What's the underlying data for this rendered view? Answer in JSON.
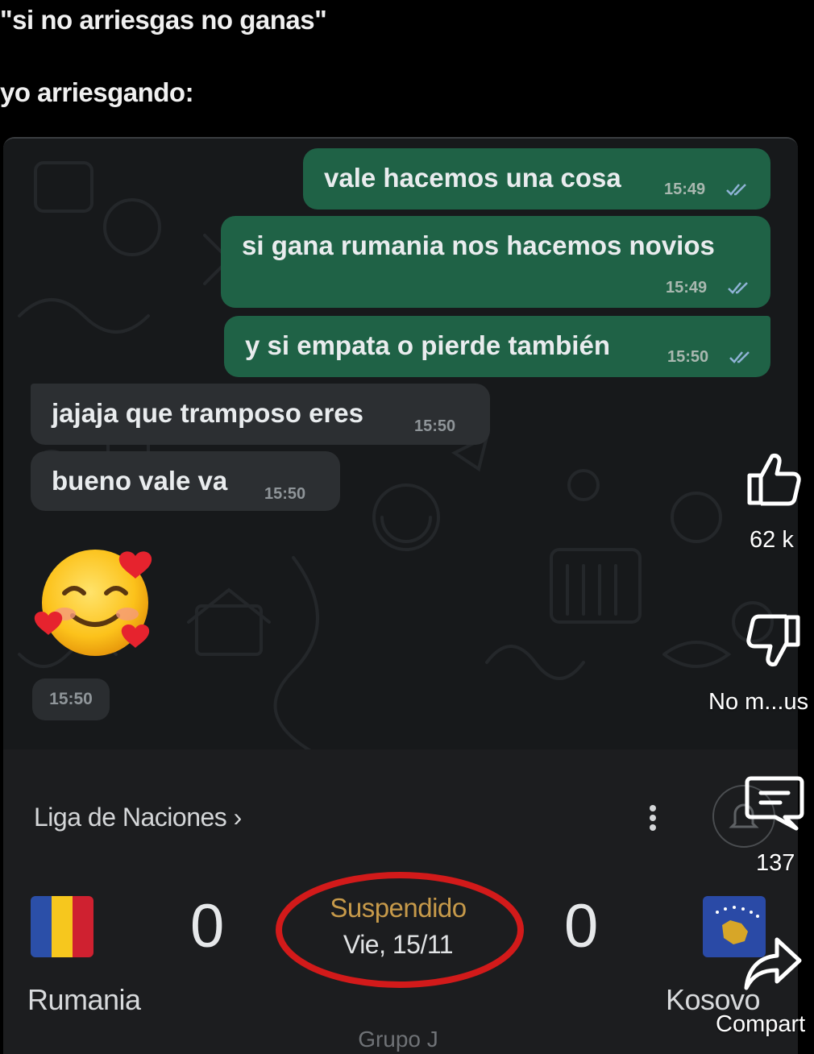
{
  "caption": {
    "line1": "\"si no arriesgas no ganas\"",
    "line2": "yo arriesgando:"
  },
  "chat": {
    "messages": [
      {
        "direction": "out",
        "text": "vale hacemos una cosa",
        "time": "15:49",
        "read": true
      },
      {
        "direction": "out",
        "text": "si gana rumania nos hacemos novios",
        "time": "15:49",
        "read": true
      },
      {
        "direction": "out",
        "text": "y si empata o pierde también",
        "time": "15:50",
        "read": true
      },
      {
        "direction": "in",
        "text": "jajaja que tramposo eres",
        "time": "15:50"
      },
      {
        "direction": "in",
        "text": "bueno vale va",
        "time": "15:50"
      }
    ],
    "emoji_message": {
      "icon": "smiling-face-with-hearts-emoji",
      "time": "15:50"
    },
    "colors": {
      "outgoing": "#1f6246",
      "incoming": "#2c2f32",
      "read_tick": "#8fb3d6"
    }
  },
  "match": {
    "league": "Liga de Naciones ›",
    "home": {
      "name": "Rumania",
      "score": "0",
      "flag": "romania-flag"
    },
    "away": {
      "name": "Kosovo",
      "score": "0",
      "flag": "kosovo-flag"
    },
    "status": "Suspendido",
    "date": "Vie, 15/11",
    "group": "Grupo J",
    "highlight_color": "#d21a1a"
  },
  "actions": {
    "like_count": "62 k",
    "dislike_label": "No m...us",
    "comment_count": "137",
    "share_label": "Compart"
  }
}
